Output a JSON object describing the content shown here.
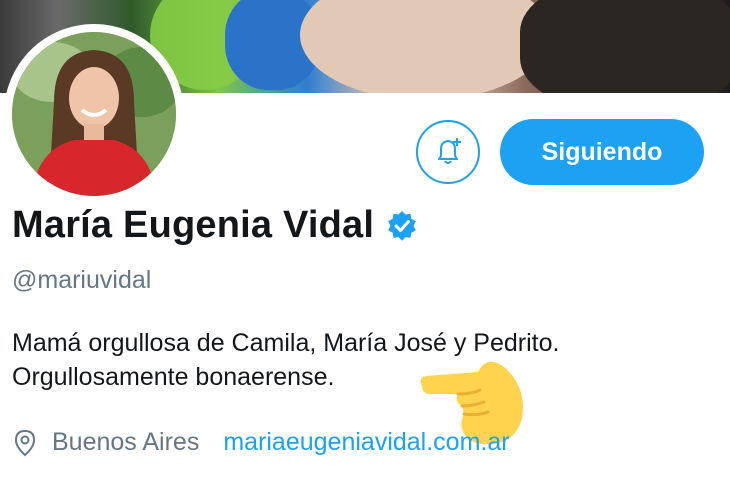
{
  "profile": {
    "name": "María Eugenia Vidal",
    "handle": "@mariuvidal",
    "bio_line1": "Mamá orgullosa de Camila, María José y Pedrito.",
    "bio_line2": "Orgullosamente bonaerense.",
    "location": "Buenos Aires",
    "website": "mariaeugeniavidal.com.ar",
    "verified": true
  },
  "actions": {
    "follow_label": "Siguiendo",
    "notifications_icon": "bell-plus-icon"
  },
  "icons": {
    "verified": "verified-badge-icon",
    "location": "location-pin-icon",
    "pointer": "pointing-hand-emoji"
  },
  "colors": {
    "accent": "#1da1f2",
    "text_primary": "#14171a",
    "text_secondary": "#657786"
  }
}
